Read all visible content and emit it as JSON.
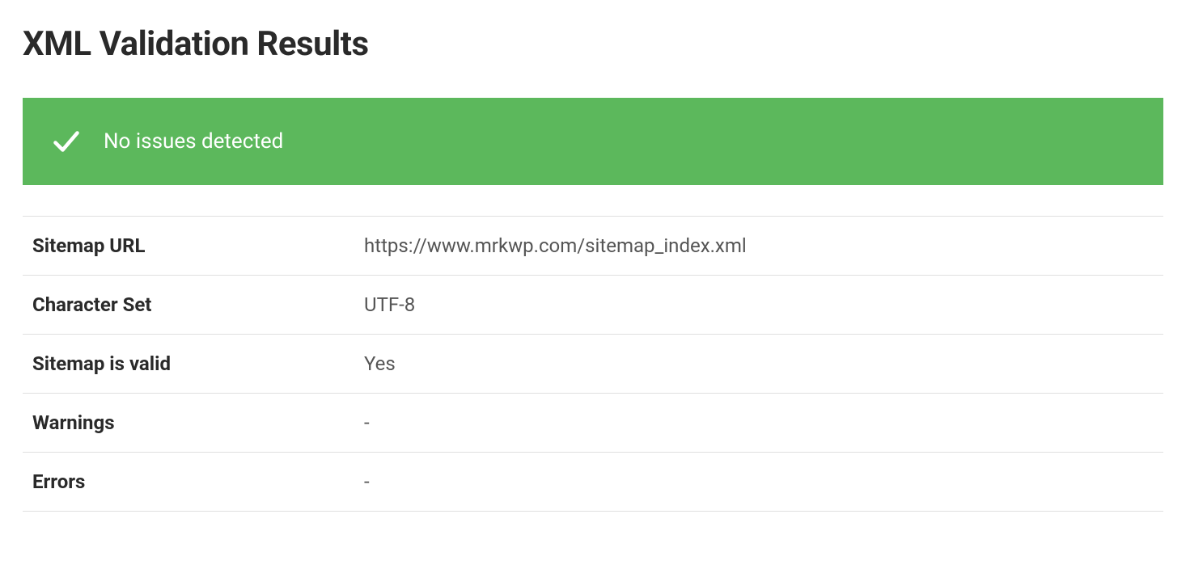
{
  "title": "XML Validation Results",
  "status": {
    "message": "No issues detected"
  },
  "results": {
    "rows": [
      {
        "label": "Sitemap URL",
        "value": "https://www.mrkwp.com/sitemap_index.xml"
      },
      {
        "label": "Character Set",
        "value": "UTF-8"
      },
      {
        "label": "Sitemap is valid",
        "value": "Yes"
      },
      {
        "label": "Warnings",
        "value": "-"
      },
      {
        "label": "Errors",
        "value": "-"
      }
    ]
  }
}
